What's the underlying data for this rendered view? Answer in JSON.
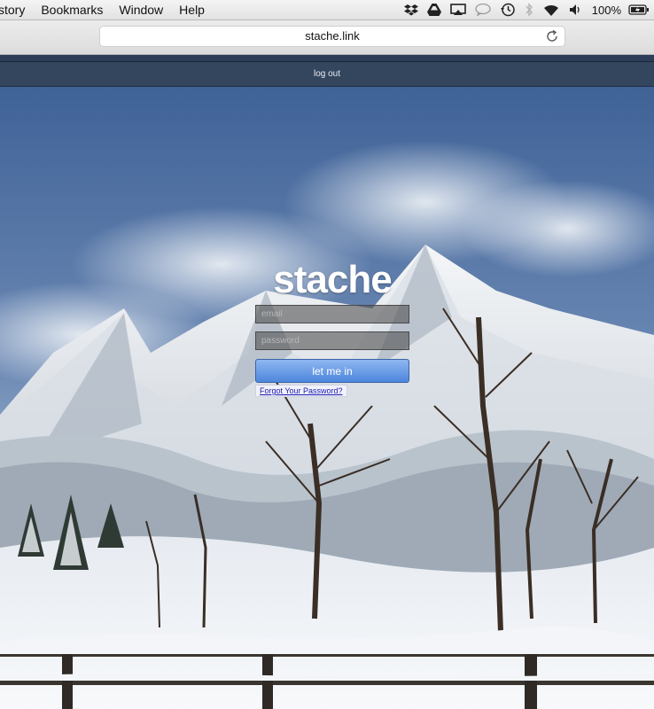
{
  "menubar": {
    "items": [
      "story",
      "Bookmarks",
      "Window",
      "Help"
    ],
    "battery_text": "100%",
    "status_icons": [
      "dropbox-icon",
      "google-drive-icon",
      "airplay-icon",
      "messages-icon",
      "time-machine-icon",
      "bluetooth-icon",
      "wifi-icon",
      "volume-icon",
      "battery-icon"
    ]
  },
  "browser": {
    "url": "stache.link"
  },
  "page": {
    "logout_label": "log out",
    "brand": "stache",
    "email_placeholder": "email",
    "password_placeholder": "password",
    "submit_label": "let me in",
    "forgot_label": "Forgot Your Password?"
  },
  "colors": {
    "nav_bg": "#34455e",
    "submit_top": "#8fb7f2",
    "submit_bottom": "#4d86dc",
    "link": "#1a1aa8"
  }
}
